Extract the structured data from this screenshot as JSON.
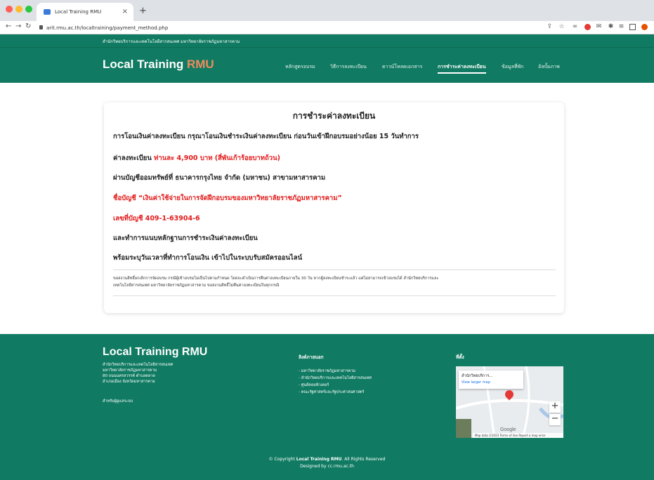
{
  "browser": {
    "tab_title": "Local Training RMU",
    "url": "arit.rmu.ac.th/localtraining/payment_method.php"
  },
  "site": {
    "top_strip": "สำนักวิทยบริการและเทคโนโลยีสารสนเทศ มหาวิทยาลัยราชภัฏมหาสารคาม",
    "logo_main": "Local Training",
    "logo_accent": "RMU",
    "nav": [
      {
        "label": "หลักสูตรอบรม"
      },
      {
        "label": "วิธีการลงทะเบียน"
      },
      {
        "label": "ดาวน์โหลดเอกสาร"
      },
      {
        "label": "การชำระค่าลงทะเบียน"
      },
      {
        "label": "ข้อมูลที่พัก"
      },
      {
        "label": "อัลบั้มภาพ"
      }
    ],
    "active_nav_index": 3
  },
  "main": {
    "title": "การชำระค่าลงทะเบียน",
    "line1": "การโอนเงินค่าลงทะเบียน กรุณาโอนเงินชำระเงินค่าลงทะเบียน ก่อนวันเข้าฝึกอบรมอย่างน้อย 15 วันทำการ",
    "fee_label": "ค่าลงทะเบียน ",
    "fee_value": "ท่านละ 4,900 บาท (สี่พันเก้าร้อยบาทถ้วน)",
    "bank_line": "ผ่านบัญชีออมทรัพย์ที่ ธนาคารกรุงไทย จำกัด (มหาชน) สาขามหาสารคาม",
    "account_name": "ชื่อบัญชี “เงินค่าใช้จ่ายในการจัดฝึกอบรมของมหาวิทยาลัยราชภัฏมหาสารคาม”",
    "account_number": "เลขที่บัญชี 409-1-63904-6",
    "attach_line": "และทำการแนบหลักฐานการชำระเงินค่าลงทะเบียน",
    "time_line": "พร้อมระบุวันเวลาที่ทำการโอนเงิน เข้าไปในระบบรับสมัครออนไลน์",
    "note_line1": "ขอสงวนสิทธิ์ยกเลิกการจัดอบรม กรณีผู้เข้าอบรมไม่เป็นไปตามกำหนด โดยจะดำเนินการคืนค่าลงทะเบียนภายใน 30 วัน หากผู้ลงทะเบียนชำระแล้ว แต่ไม่สามารถเข้าอบรมได้ สำนักวิทยบริการและ",
    "note_line2": "เทคโนโลยีสารสนเทศ มหาวิทยาลัยราชภัฏมหาสารคาม ขอสงวนสิทธิ์ไม่คืนค่าลงทะเบียนในทุกกรณี"
  },
  "footer": {
    "logo": "Local Training RMU",
    "address": [
      "สำนักวิทยบริการและเทคโนโลยีสารสนเทศ",
      "มหาวิทยาลัยราชภัฏมหาสารคาม",
      "80 ถนนนครสวรรค์ ตำบลตลาด",
      "อำเภอเมือง จังหวัดมหาสารคาม"
    ],
    "staff_link": "สำหรับผู้ดูแลระบบ",
    "links_heading": "ลิงค์ภายนอก",
    "links": [
      "- มหาวิทยาลัยราชภัฏมหาสารคาม",
      "- สำนักวิทยบริการและเทคโนโลยีสารสนเทศ",
      "- ศูนย์คอมพิวเตอร์",
      "- คณะรัฐศาสตร์และรัฐประศาสนศาสตร์"
    ],
    "location_heading": "ที่ตั้ง",
    "map_place": "สำนักวิทยบริการ...",
    "map_view_larger": "View larger map",
    "map_attribution": "Map data ©2023  Terms of Use  Report a map error",
    "map_brand": "Google",
    "copyright_prefix": "© Copyright ",
    "copyright_brand": "Local Training RMU",
    "copyright_suffix": ". All Rights Reserved",
    "designed_by": "Designed by cc.rmu.ac.th"
  },
  "colors": {
    "brand_green": "#107b62",
    "accent_orange": "#f08a5d",
    "alert_red": "#e21a1a"
  }
}
